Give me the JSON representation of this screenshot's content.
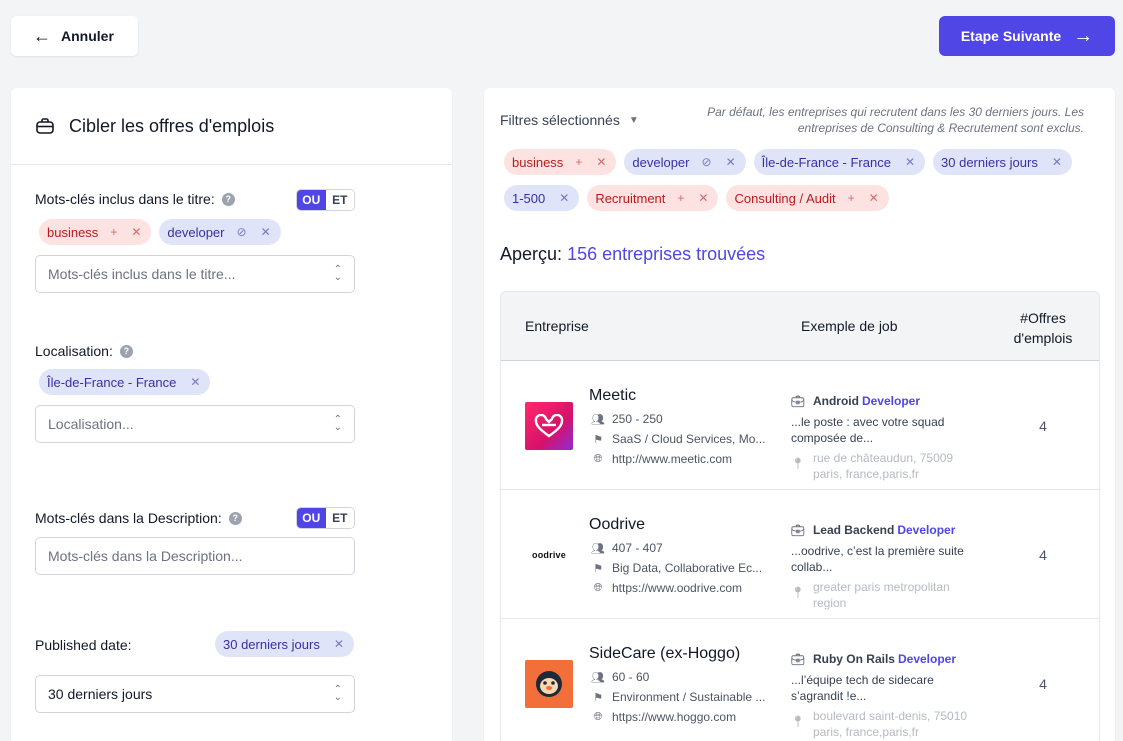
{
  "top": {
    "cancel_label": "Annuler",
    "next_label": "Etape Suivante"
  },
  "left": {
    "title": "Cibler les offres d'emplois",
    "title_keywords": {
      "label": "Mots-clés inclus dans le titre:",
      "toggle_or": "OU",
      "toggle_and": "ET",
      "chips": [
        {
          "label": "business",
          "type": "include"
        },
        {
          "label": "developer",
          "type": "exclude"
        }
      ],
      "placeholder": "Mots-clés inclus dans le titre..."
    },
    "location": {
      "label": "Localisation:",
      "chip": "Île-de-France - France",
      "placeholder": "Localisation..."
    },
    "description_keywords": {
      "label": "Mots-clés dans la Description:",
      "toggle_or": "OU",
      "toggle_and": "ET",
      "placeholder": "Mots-clés dans la Description..."
    },
    "published": {
      "label": "Published date:",
      "chip": "30 derniers jours",
      "value": "30 derniers jours"
    }
  },
  "right": {
    "filters_label": "Filtres sélectionnés",
    "default_note": "Par défaut, les entreprises qui recrutent dans les 30 derniers jours. Les entreprises de Consulting & Recrutement sont exclus.",
    "filter_chips": [
      {
        "label": "business",
        "color": "red",
        "icon": "plus"
      },
      {
        "label": "developer",
        "color": "blue",
        "icon": "ban"
      },
      {
        "label": "Île-de-France - France",
        "color": "blue",
        "icon": ""
      },
      {
        "label": "30 derniers jours",
        "color": "blue",
        "icon": ""
      },
      {
        "label": "1-500",
        "color": "blue",
        "icon": ""
      },
      {
        "label": "Recruitment",
        "color": "red",
        "icon": "plus"
      },
      {
        "label": "Consulting / Audit",
        "color": "red",
        "icon": "plus"
      }
    ],
    "apercu_label": "Aperçu:",
    "apercu_count": "156 entreprises trouvées",
    "table": {
      "headers": {
        "company": "Entreprise",
        "job": "Exemple de job",
        "offers_line1": "#Offres",
        "offers_line2": "d'emplois"
      },
      "rows": [
        {
          "name": "Meetic",
          "size": "250 - 250",
          "industry": "SaaS / Cloud Services, Mo...",
          "url": "http://www.meetic.com",
          "job_title": "Android",
          "job_keyword": "Developer",
          "job_desc": "...le poste : avec votre squad composée de...",
          "job_location": "rue de châteaudun, 75009 paris, france,paris,fr",
          "offers": "4",
          "logo_color": "#e6154f"
        },
        {
          "name": "Oodrive",
          "size": "407 - 407",
          "industry": "Big Data, Collaborative Ec...",
          "url": "https://www.oodrive.com",
          "job_title": "Lead Backend",
          "job_keyword": "Developer",
          "job_desc": "...oodrive, c’est la première suite collab...",
          "job_location": "greater paris metropolitan region",
          "offers": "4",
          "logo_text": "oodrive"
        },
        {
          "name": "SideCare (ex-Hoggo)",
          "size": "60 - 60",
          "industry": "Environment / Sustainable ...",
          "url": "https://www.hoggo.com",
          "job_title": "Ruby On Rails",
          "job_keyword": "Developer",
          "job_desc": "...l’équipe tech de sidecare s’agrandit !e...",
          "job_location": "boulevard saint-denis, 75010 paris, france,paris,fr",
          "offers": "4",
          "logo_color": "#f26f3a"
        }
      ]
    }
  }
}
